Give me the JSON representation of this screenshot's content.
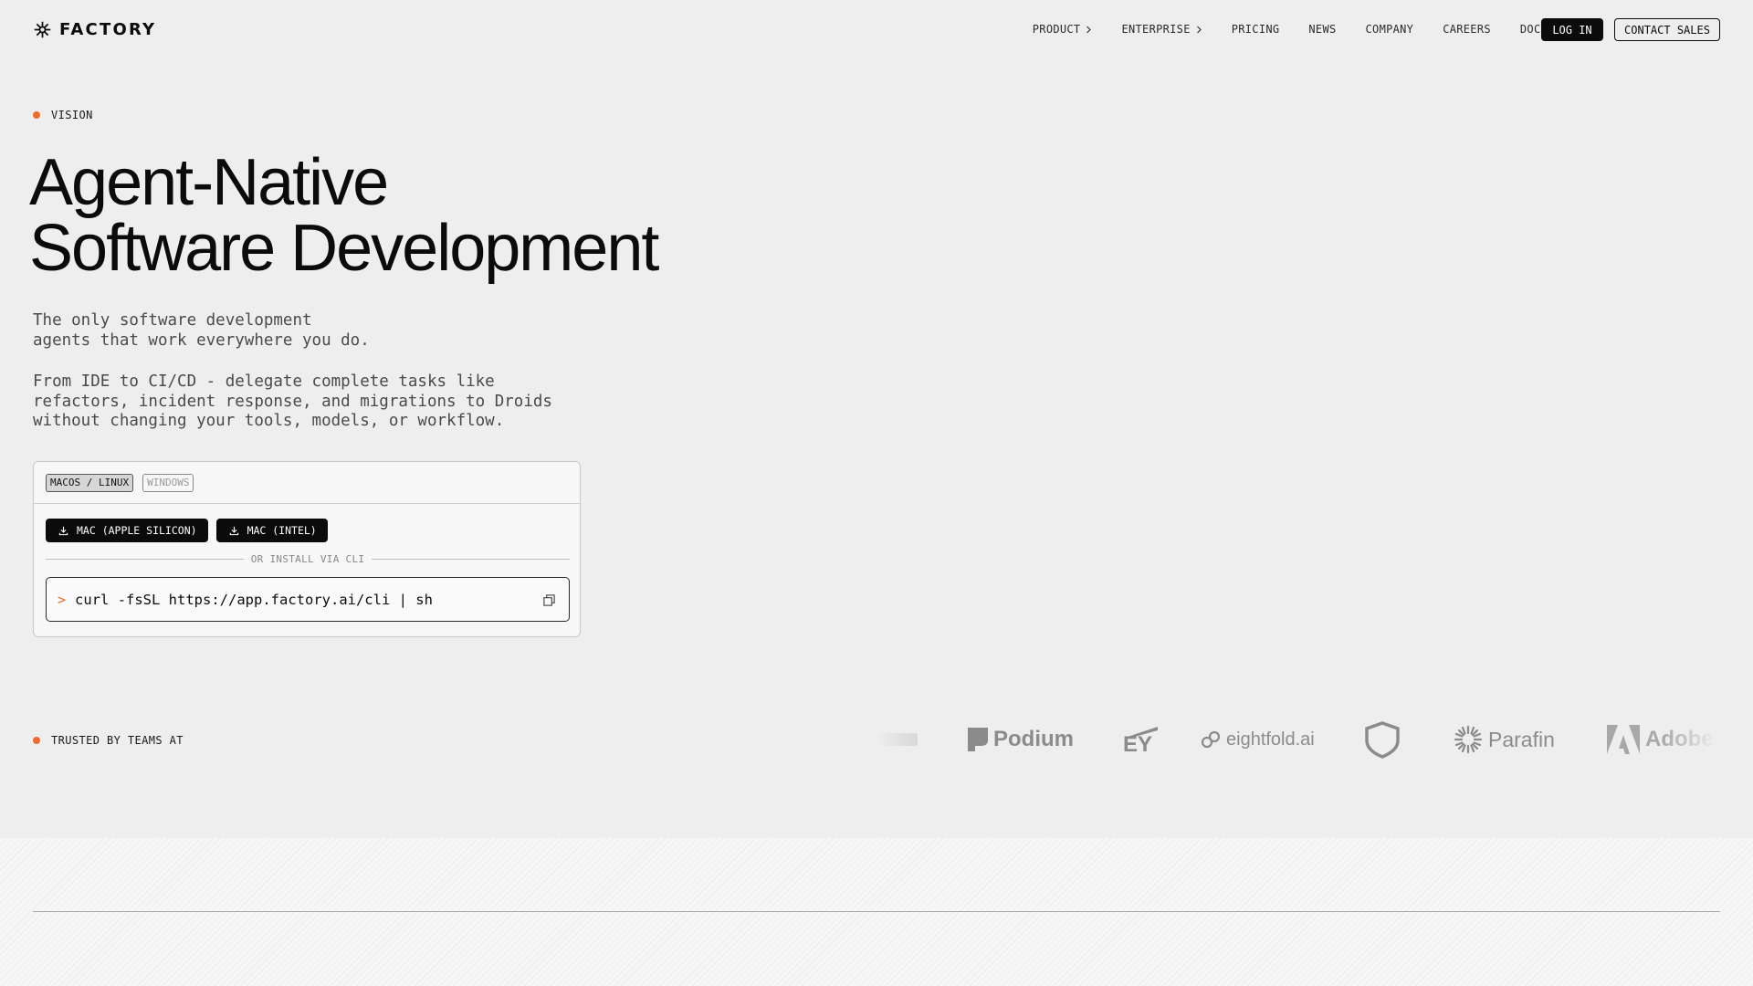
{
  "nav": {
    "logo_text": "FACTORY",
    "links": [
      {
        "label": "PRODUCT",
        "has_chevron": true
      },
      {
        "label": "ENTERPRISE",
        "has_chevron": true
      },
      {
        "label": "PRICING",
        "has_chevron": false
      },
      {
        "label": "NEWS",
        "has_chevron": false
      },
      {
        "label": "COMPANY",
        "has_chevron": false
      },
      {
        "label": "CAREERS",
        "has_chevron": false
      },
      {
        "label": "DOCS",
        "has_chevron": false
      }
    ],
    "login_label": "LOG IN",
    "contact_label": "CONTACT SALES"
  },
  "hero": {
    "tag": "VISION",
    "title_line1": "Agent-Native",
    "title_line2": "Software Development",
    "desc1_line1": "The only software development",
    "desc1_line2": "agents that work everywhere you do.",
    "desc2_line1": "From IDE to CI/CD - delegate complete tasks like",
    "desc2_line2": "refactors, incident response, and migrations to Droids",
    "desc2_line3": "without changing your tools, models, or workflow."
  },
  "install": {
    "tabs": [
      {
        "label": "MACOS / LINUX",
        "active": true
      },
      {
        "label": "WINDOWS",
        "active": false
      }
    ],
    "download_buttons": [
      "MAC (APPLE SILICON)",
      "MAC (INTEL)"
    ],
    "divider_text": "OR INSTALL VIA CLI",
    "cli_prompt": ">",
    "cli_command": "curl -fsSL https://app.factory.ai/cli | sh"
  },
  "trusted": {
    "tag": "TRUSTED BY TEAMS AT",
    "logos": [
      "Podium",
      "EY",
      "eightfold.ai",
      "Parafin",
      "Adobe"
    ]
  },
  "colors": {
    "accent": "#ef6a2c",
    "background": "#eeeeee",
    "text": "#0b0b0b",
    "logo_gray": "#8b8b8b"
  }
}
